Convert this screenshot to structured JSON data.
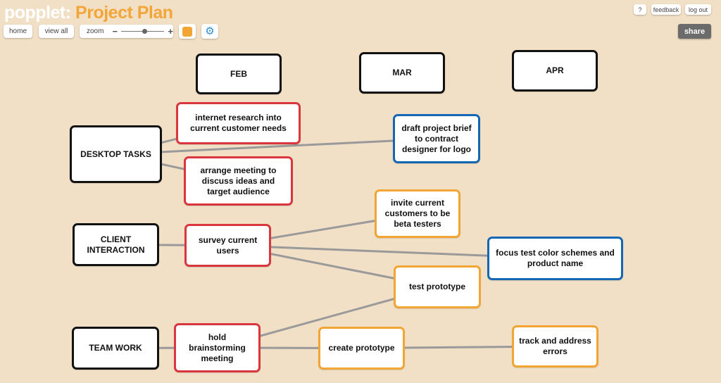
{
  "header": {
    "brand": "popplet:",
    "title": "Project Plan",
    "title_color": "#f2a63a"
  },
  "toolbar": {
    "home_label": "home",
    "view_all_label": "view all",
    "zoom_label": "zoom",
    "zoom_minus": "−",
    "zoom_plus": "+",
    "zoom_level": 0.55,
    "color_swatch": "#f0a535",
    "settings_icon": "gear-icon"
  },
  "top_right": {
    "help_label": "?",
    "feedback_label": "feedback",
    "logout_label": "log out",
    "share_label": "share"
  },
  "colors": {
    "background": "#f2e0c6",
    "black": "#111111",
    "red": "#d9363e",
    "blue": "#1467b3",
    "orange": "#f0a535",
    "connector": "#9a9a9a"
  },
  "popplets": {
    "feb": {
      "text": "FEB",
      "color": "black"
    },
    "mar": {
      "text": "MAR",
      "color": "black"
    },
    "apr": {
      "text": "APR",
      "color": "black"
    },
    "desktop_tasks": {
      "text": "DESKTOP TASKS",
      "color": "black"
    },
    "internet_research": {
      "text": "internet research into current customer needs",
      "color": "red"
    },
    "arrange_meeting": {
      "text": "arrange meeting to discuss ideas and target audience",
      "color": "red"
    },
    "draft_brief": {
      "text": "draft project brief to contract designer for logo",
      "color": "blue"
    },
    "invite_customers": {
      "text": "invite current customers to be beta testers",
      "color": "orange"
    },
    "client_interaction": {
      "text": "CLIENT INTERACTION",
      "color": "black"
    },
    "survey_users": {
      "text": "survey current users",
      "color": "red"
    },
    "focus_test": {
      "text": "focus test color schemes and product name",
      "color": "blue"
    },
    "test_prototype": {
      "text": "test prototype",
      "color": "orange"
    },
    "team_work": {
      "text": "TEAM WORK",
      "color": "black"
    },
    "brainstorm": {
      "text": "hold brainstorming meeting",
      "color": "red"
    },
    "create_prototype": {
      "text": "create prototype",
      "color": "orange"
    },
    "track_errors": {
      "text": "track and address errors",
      "color": "orange"
    }
  },
  "connections": [
    [
      "desktop_tasks",
      "internet_research"
    ],
    [
      "desktop_tasks",
      "draft_brief"
    ],
    [
      "desktop_tasks",
      "arrange_meeting"
    ],
    [
      "client_interaction",
      "survey_users"
    ],
    [
      "survey_users",
      "invite_customers"
    ],
    [
      "survey_users",
      "focus_test"
    ],
    [
      "survey_users",
      "test_prototype"
    ],
    [
      "brainstorm",
      "test_prototype"
    ],
    [
      "team_work",
      "brainstorm"
    ],
    [
      "brainstorm",
      "create_prototype"
    ],
    [
      "create_prototype",
      "track_errors"
    ]
  ]
}
